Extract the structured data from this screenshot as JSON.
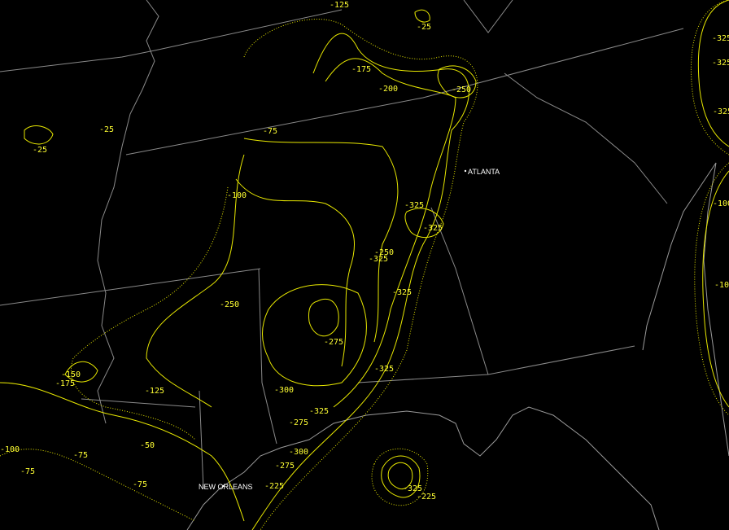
{
  "map": {
    "cities": [
      {
        "name": "ATLANTA"
      },
      {
        "name": "NEW ORLEANS"
      }
    ],
    "contour_labels": [
      "-125",
      "-25",
      "-175",
      "-200",
      "-250",
      "-25",
      "-25",
      "-75",
      "-100",
      "-325",
      "-325",
      "-325",
      "-250",
      "-325",
      "-325",
      "-250",
      "-275",
      "-150",
      "-175",
      "-125",
      "-300",
      "-50",
      "-75",
      "-100",
      "-75",
      "-75",
      "-275",
      "-325",
      "-300",
      "-275",
      "-225",
      "-325",
      "-225",
      "-325",
      "-325",
      "-100",
      "-325",
      "-100"
    ],
    "colors": {
      "background": "#000000",
      "contour": "#e8e800",
      "borders": "#8a8a8a",
      "city_label": "#ffffff"
    }
  }
}
